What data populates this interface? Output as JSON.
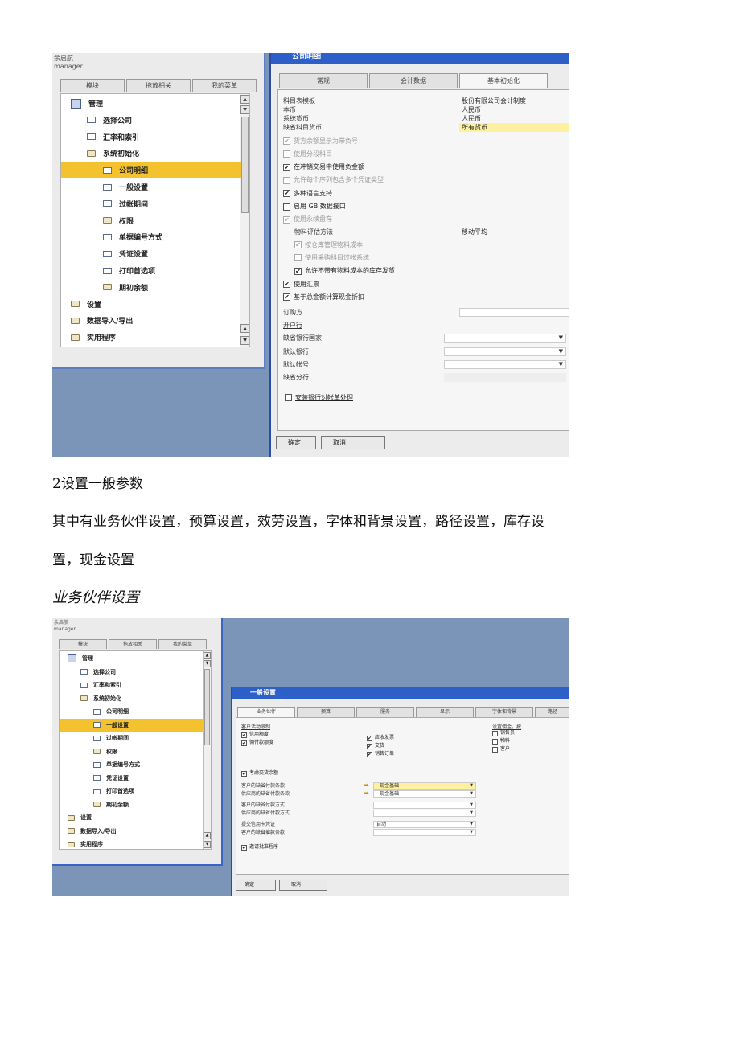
{
  "shot1": {
    "user": {
      "name": "余启航",
      "role": "manager"
    },
    "left_tabs": [
      "模块",
      "拖放相关",
      "我的菜单"
    ],
    "tree": [
      {
        "label": "管理",
        "icon": "root",
        "indent": 0,
        "selected": false
      },
      {
        "label": "选择公司",
        "icon": "doc",
        "indent": 1,
        "selected": false
      },
      {
        "label": "汇率和索引",
        "icon": "doc",
        "indent": 1,
        "selected": false
      },
      {
        "label": "系统初始化",
        "icon": "folder",
        "indent": 1,
        "selected": false
      },
      {
        "label": "公司明细",
        "icon": "doc",
        "indent": 2,
        "selected": true
      },
      {
        "label": "一般设置",
        "icon": "doc",
        "indent": 2,
        "selected": false
      },
      {
        "label": "过帐期间",
        "icon": "doc",
        "indent": 2,
        "selected": false
      },
      {
        "label": "权限",
        "icon": "folder",
        "indent": 2,
        "selected": false
      },
      {
        "label": "单据编号方式",
        "icon": "doc",
        "indent": 2,
        "selected": false
      },
      {
        "label": "凭证设置",
        "icon": "doc",
        "indent": 2,
        "selected": false
      },
      {
        "label": "打印首选项",
        "icon": "doc",
        "indent": 2,
        "selected": false
      },
      {
        "label": "期初余额",
        "icon": "folder",
        "indent": 2,
        "selected": false
      },
      {
        "label": "设置",
        "icon": "folder",
        "indent": 0,
        "selected": false
      },
      {
        "label": "数据导入/导出",
        "icon": "folder",
        "indent": 0,
        "selected": false
      },
      {
        "label": "实用程序",
        "icon": "folder",
        "indent": 0,
        "selected": false
      }
    ],
    "window_title": "公司明细",
    "right_tabs": [
      "常规",
      "会计数据",
      "基本初始化"
    ],
    "fields_top": [
      {
        "label": "科目表模板",
        "value": "股份有限公司会计制度",
        "highlight": false
      },
      {
        "label": "本币",
        "value": "人民币",
        "highlight": false
      },
      {
        "label": "系统货币",
        "value": "人民币",
        "highlight": false
      },
      {
        "label": "缺省科目货币",
        "value": "所有货币",
        "highlight": true
      }
    ],
    "checks_a": [
      {
        "label": "货方余额显示为带负号",
        "checked": true,
        "disabled": true,
        "indent": 0
      },
      {
        "label": "使用分段科目",
        "checked": false,
        "disabled": true,
        "indent": 0
      },
      {
        "label": "在冲销交易中使用负金额",
        "checked": true,
        "disabled": false,
        "indent": 0
      },
      {
        "label": "允许每个序列包含多个凭证类型",
        "checked": false,
        "disabled": true,
        "indent": 0
      },
      {
        "label": "多种语言支持",
        "checked": true,
        "disabled": false,
        "indent": 0
      },
      {
        "label": "启用 GB 数据接口",
        "checked": false,
        "disabled": false,
        "indent": 0
      },
      {
        "label": "使用永续盘存",
        "checked": true,
        "disabled": true,
        "indent": 0
      }
    ],
    "valuation": {
      "label": "物料评估方法",
      "value": "移动平均"
    },
    "checks_b": [
      {
        "label": "按仓库管理物料成本",
        "checked": true,
        "disabled": true,
        "indent": 1
      },
      {
        "label": "使用采购科目过帐系统",
        "checked": false,
        "disabled": true,
        "indent": 1
      },
      {
        "label": "允许不带有物料成本的库存发货",
        "checked": true,
        "disabled": false,
        "indent": 1
      },
      {
        "label": "使用汇票",
        "checked": true,
        "disabled": false,
        "indent": 0
      },
      {
        "label": "基于总金额计算现金折扣",
        "checked": true,
        "disabled": false,
        "indent": 0
      }
    ],
    "fields_bottom": [
      {
        "label": "订购方",
        "value": "",
        "kind": "input"
      },
      {
        "label": "开户行",
        "value": "",
        "kind": "link"
      },
      {
        "label": "缺省银行国家",
        "value": "",
        "kind": "drop"
      },
      {
        "label": "默认银行",
        "value": "",
        "kind": "drop"
      },
      {
        "label": "默认帐号",
        "value": "",
        "kind": "drop"
      },
      {
        "label": "缺省分行",
        "value": "",
        "kind": "plain"
      }
    ],
    "check_bank": {
      "label": "安装银行对帐单处理",
      "checked": false
    },
    "buttons": {
      "ok": "确定",
      "cancel": "取消"
    }
  },
  "doc": {
    "heading": "2设置一般参数",
    "para_line1": "其中有业务伙伴设置，预算设置，效劳设置，字体和背景设置，路径设置，库存设",
    "para_line2": "置，现金设置",
    "subheading": "业务伙伴设置"
  },
  "shot2": {
    "window_title": "一般设置",
    "tabs": [
      "业务伙伴",
      "预算",
      "服务",
      "显示",
      "字体和背景",
      "路径"
    ],
    "section_label": "客户活动限制",
    "left_checks": [
      {
        "label": "信用额度",
        "checked": true
      },
      {
        "label": "佣付款额度",
        "checked": true
      }
    ],
    "mid_checks": [
      {
        "label": "应收发票",
        "checked": true
      },
      {
        "label": "交货",
        "checked": true
      },
      {
        "label": "销售订单",
        "checked": true
      }
    ],
    "right_group": {
      "label": "设置佣金，按",
      "items": [
        {
          "label": "销售员",
          "checked": false
        },
        {
          "label": "物料",
          "checked": false
        },
        {
          "label": "客户",
          "checked": false
        }
      ]
    },
    "check_open": {
      "label": "考虑交货余额",
      "checked": true
    },
    "fields": [
      {
        "label": "客户的缺省付款条款",
        "value": "- 现金基础 -",
        "highlight": true,
        "arrow": true
      },
      {
        "label": "供应商的缺省付款条款",
        "value": "- 现金基础 -",
        "highlight": false,
        "arrow": true
      },
      {
        "label": "客户的缺省付款方式",
        "value": "",
        "highlight": false,
        "arrow": false
      },
      {
        "label": "供应商的缺省付款方式",
        "value": "",
        "highlight": false,
        "arrow": false
      },
      {
        "label": "提交信用卡凭证",
        "value": "自动",
        "highlight": false,
        "arrow": false
      },
      {
        "label": "客户的缺省催款条款",
        "value": "",
        "highlight": false,
        "arrow": false
      }
    ],
    "check_bottom": {
      "label": "邀请批准程序",
      "checked": true
    },
    "buttons": {
      "ok": "确定",
      "cancel": "取消"
    }
  }
}
